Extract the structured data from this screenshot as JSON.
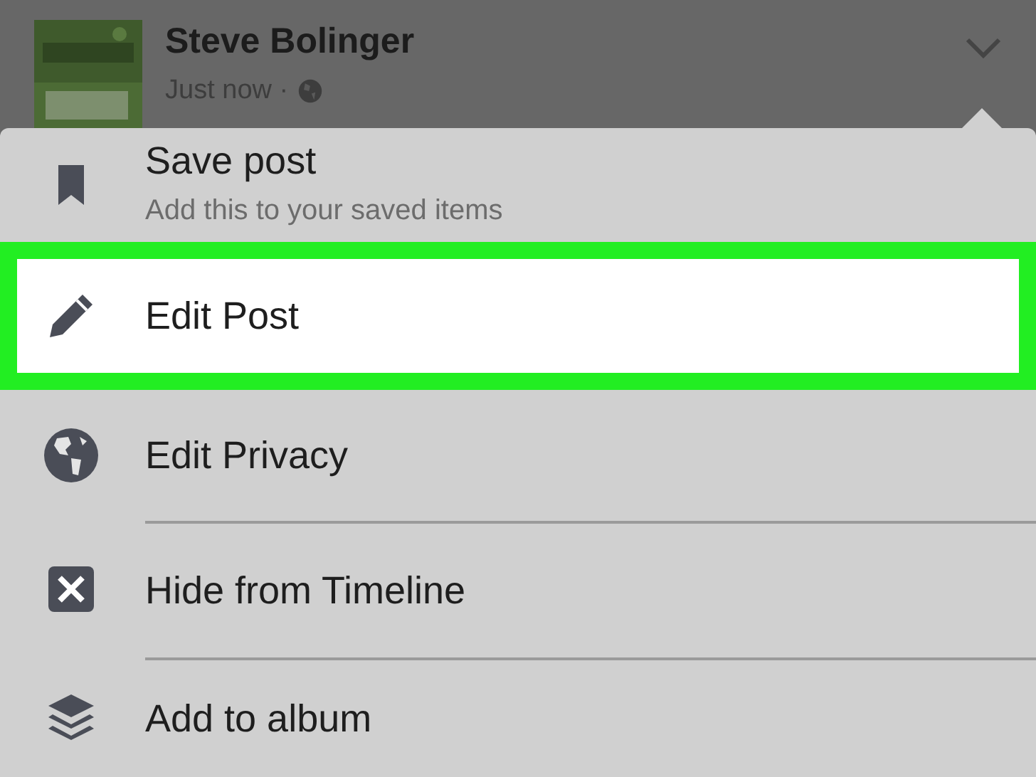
{
  "post_header": {
    "author": "Steve Bolinger",
    "timestamp": "Just now ·"
  },
  "menu_items": [
    {
      "kind": "bookmark",
      "label": "Save post",
      "subtitle": "Add this to your saved items",
      "selected": false
    },
    {
      "kind": "pencil",
      "label": "Edit Post",
      "selected": true
    },
    {
      "kind": "globe",
      "label": "Edit Privacy",
      "selected": false
    },
    {
      "kind": "xbox",
      "label": "Hide from Timeline",
      "selected": false
    },
    {
      "kind": "layers",
      "label": "Add to album",
      "selected": false
    }
  ]
}
